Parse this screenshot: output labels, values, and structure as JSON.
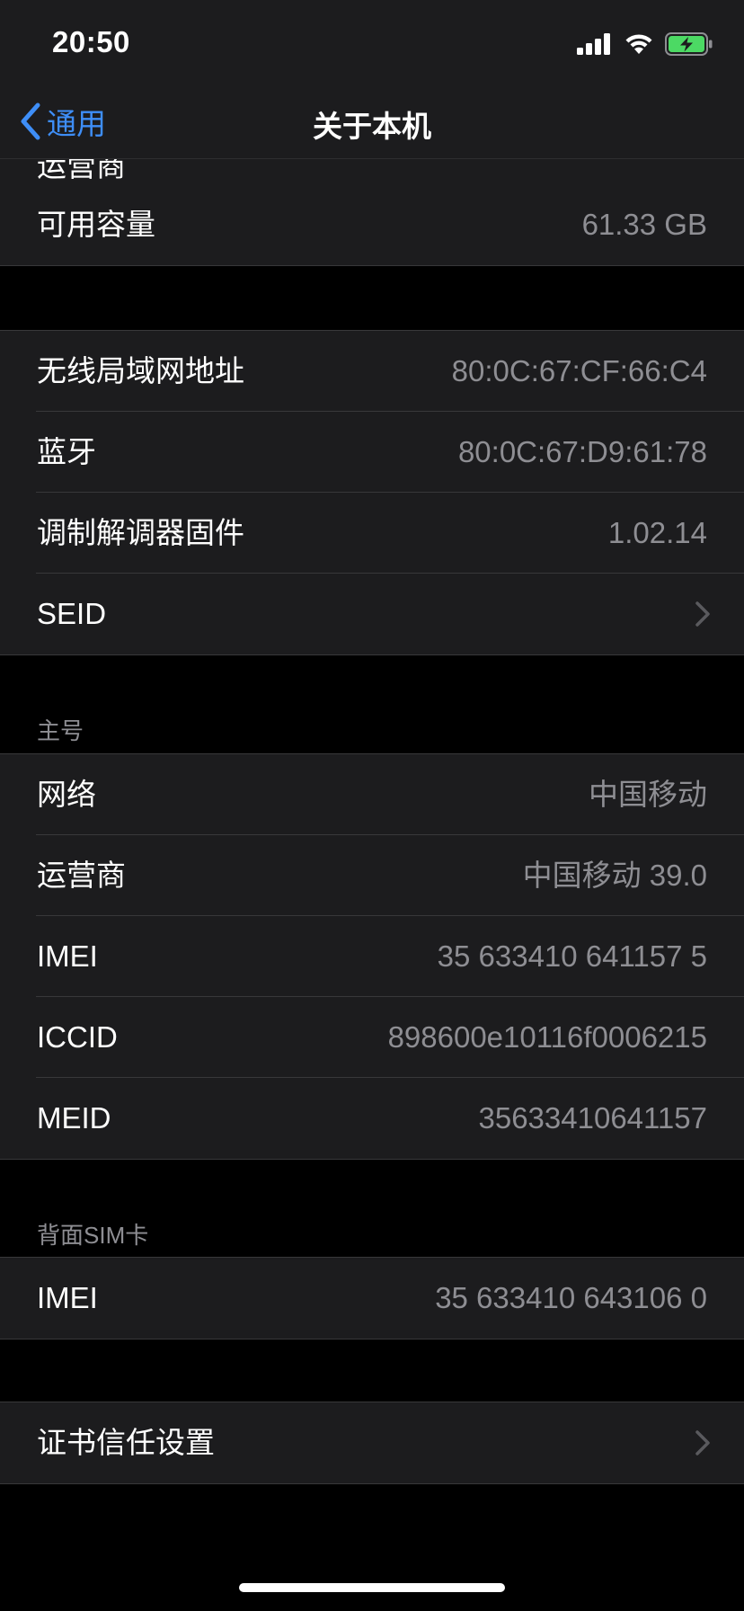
{
  "status_bar": {
    "time": "20:50",
    "signal_icon": "cellular-signal-icon",
    "wifi_icon": "wifi-icon",
    "battery_icon": "battery-charging-icon",
    "battery_color": "#4cd964"
  },
  "nav": {
    "back_label": "通用",
    "title": "关于本机",
    "accent": "#3e8ef7"
  },
  "top_partial": {
    "label": "运营商"
  },
  "storage": {
    "rows": [
      {
        "label": "可用容量",
        "value": "61.33 GB"
      }
    ]
  },
  "network_info": {
    "rows": [
      {
        "label": "无线局域网地址",
        "value": "80:0C:67:CF:66:C4"
      },
      {
        "label": "蓝牙",
        "value": "80:0C:67:D9:61:78"
      },
      {
        "label": "调制解调器固件",
        "value": "1.02.14"
      },
      {
        "label": "SEID",
        "value": ""
      }
    ]
  },
  "primary_line": {
    "header": "主号",
    "rows": [
      {
        "label": "网络",
        "value": "中国移动"
      },
      {
        "label": "运营商",
        "value": "中国移动 39.0"
      },
      {
        "label": "IMEI",
        "value": "35 633410 641157 5"
      },
      {
        "label": "ICCID",
        "value": "898600e10116f0006215"
      },
      {
        "label": "MEID",
        "value": "35633410641157"
      }
    ]
  },
  "back_sim": {
    "header": "背面SIM卡",
    "rows": [
      {
        "label": "IMEI",
        "value": "35 633410 643106 0"
      }
    ]
  },
  "certificates": {
    "rows": [
      {
        "label": "证书信任设置",
        "value": ""
      }
    ]
  }
}
